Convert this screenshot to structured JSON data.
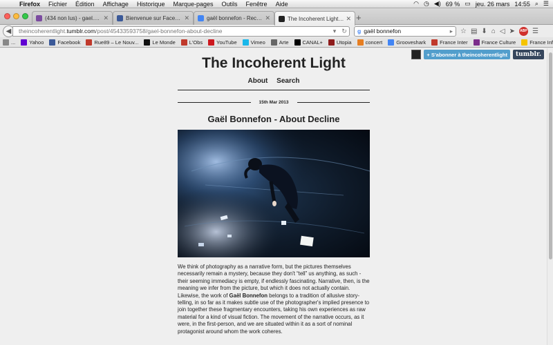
{
  "menubar": {
    "app": "Firefox",
    "items": [
      "Fichier",
      "Édition",
      "Affichage",
      "Historique",
      "Marque-pages",
      "Outils",
      "Fenêtre",
      "Aide"
    ],
    "battery": "69 %",
    "datetime": "jeu. 26 mars",
    "time": "14:55"
  },
  "tabs": [
    {
      "label": "(434 non lus) - gael.bonn...",
      "favicon_color": "#7b4ba0"
    },
    {
      "label": "Bienvenue sur Facebook...",
      "favicon_color": "#3b5998"
    },
    {
      "label": "gaël bonnefon - Recherch...",
      "favicon_color": "#4285f4"
    },
    {
      "label": "The Incoherent Light | Ga...",
      "favicon_color": "#222222"
    }
  ],
  "urlbar": {
    "prefix": "theincoherentlight.",
    "host": "tumblr.com",
    "path": "/post/45433593758/gael-bonnefon-about-decline"
  },
  "search": {
    "query": "gaël bonnefon"
  },
  "bookmarks": [
    {
      "label": "...",
      "color": "#888888"
    },
    {
      "label": "Yahoo",
      "color": "#6001d2"
    },
    {
      "label": "Facebook",
      "color": "#3b5998"
    },
    {
      "label": "Rue89 – Le Nouv...",
      "color": "#c0392b"
    },
    {
      "label": "Le Monde",
      "color": "#111111"
    },
    {
      "label": "L'Obs",
      "color": "#c0392b"
    },
    {
      "label": "YouTube",
      "color": "#cc181e"
    },
    {
      "label": "Vimeo",
      "color": "#1ab7ea"
    },
    {
      "label": "Arte",
      "color": "#666666"
    },
    {
      "label": "CANAL+",
      "color": "#000000"
    },
    {
      "label": "Utopia",
      "color": "#8e1c1c"
    },
    {
      "label": "concert",
      "color": "#e67e22"
    },
    {
      "label": "Grooveshark",
      "color": "#4285f4"
    },
    {
      "label": "France Inter",
      "color": "#c0392b"
    },
    {
      "label": "France Culture",
      "color": "#7b2d8b"
    },
    {
      "label": "France Info",
      "color": "#f5c400"
    }
  ],
  "tumblr_controls": {
    "follow": "+ S'abonner à theincoherentlight",
    "logo": "tumblr."
  },
  "blog": {
    "title": "The Incoherent Light",
    "nav": [
      "About",
      "Search"
    ],
    "date": "15th Mar 2013",
    "post_title": "Gaël Bonnefon - About Decline",
    "body_before": "We think of photography as a narrative form, but the pictures themselves necessarily remain a mystery, because they don't “tell” us anything, as such - their seeming immediacy is empty, if endlessly fascinating. Narrative, then, is the meaning we infer from the picture, but which it does not actually contain. Likewise, the work of ",
    "body_bold": "Gaël Bonnefon",
    "body_after": " belongs to a tradition of allusive story-telling, in so far as it makes subtle use of the photographer's implied presence to join together these fragmentary encounters, taking his own experiences as raw material for a kind of visual fiction. The movement of the narrative occurs, as it were, in the first-person, and we are situated within it as a sort of nominal protagonist around whom the work coheres."
  }
}
